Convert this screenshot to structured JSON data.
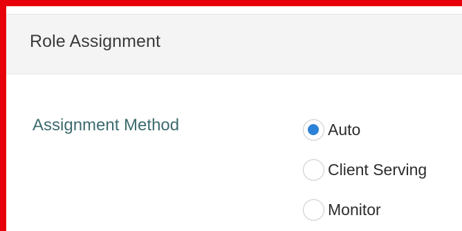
{
  "section": {
    "title": "Role Assignment"
  },
  "assignment_method": {
    "label": "Assignment Method",
    "selected": "Auto",
    "options": [
      {
        "label": "Auto",
        "checked": true
      },
      {
        "label": "Client Serving",
        "checked": false
      },
      {
        "label": "Monitor",
        "checked": false
      }
    ]
  },
  "colors": {
    "highlight_border": "#e8000a",
    "radio_selected": "#2d82d7",
    "label_text": "#3d6b6e"
  }
}
